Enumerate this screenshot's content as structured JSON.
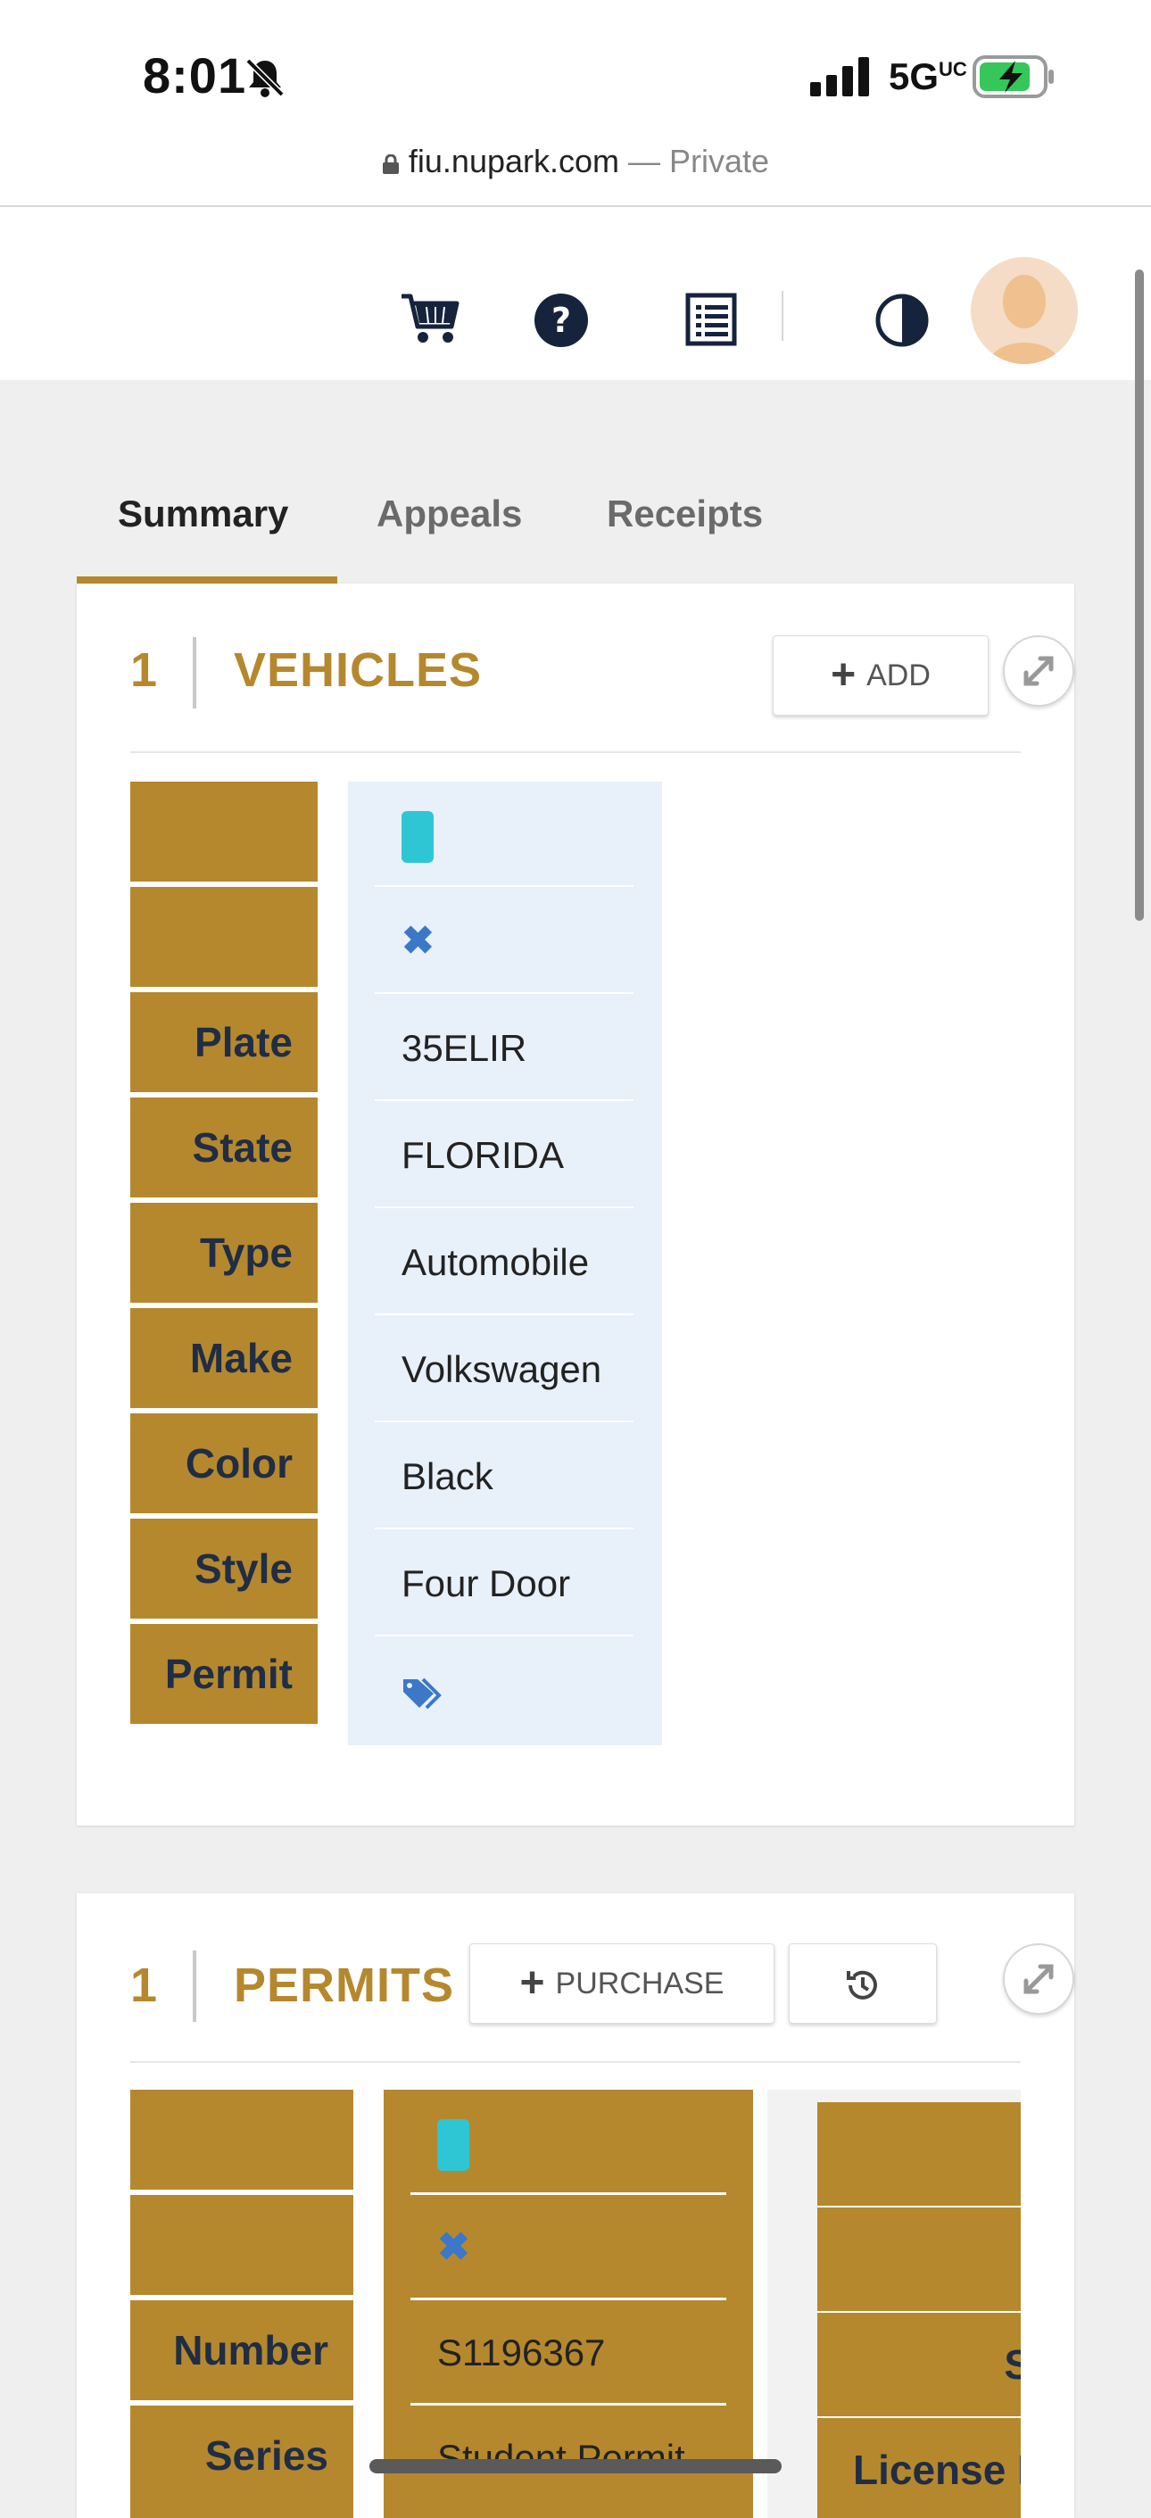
{
  "status_bar": {
    "time": "8:01",
    "network": "5G",
    "network_sup": "UC",
    "battery_charging": true
  },
  "browser": {
    "domain": "fiu.nupark.com",
    "separator": " — ",
    "mode": "Private"
  },
  "app_bar": {
    "icons": [
      "cart-icon",
      "help-icon",
      "list-icon",
      "contrast-icon"
    ],
    "avatar": "avatar"
  },
  "tabs": [
    {
      "label": "Summary",
      "active": true
    },
    {
      "label": "Appeals",
      "active": false
    },
    {
      "label": "Receipts",
      "active": false
    }
  ],
  "vehicles": {
    "count": "1",
    "title": "VEHICLES",
    "add_label": "ADD",
    "labels": [
      "",
      "",
      "Plate",
      "State",
      "Type",
      "Make",
      "Color",
      "Style",
      "Permit"
    ],
    "values": {
      "plate": "35ELIR",
      "state": "FLORIDA",
      "type": "Automobile",
      "make": "Volkswagen",
      "color": "Black",
      "style": "Four Door"
    }
  },
  "permits": {
    "count": "1",
    "title": "PERMITS",
    "purchase_label": "PURCHASE",
    "labels": [
      "",
      "",
      "Number",
      "Series"
    ],
    "values": {
      "number": "S1196367",
      "series": "Student Permit"
    },
    "third_col_labels": [
      "S",
      "License P"
    ]
  },
  "colors": {
    "gold": "#b5882e",
    "navy": "#1f2d45",
    "light_blue": "#e8f0fa",
    "teal": "#2ec6d4",
    "x_blue": "#3b78c7"
  }
}
